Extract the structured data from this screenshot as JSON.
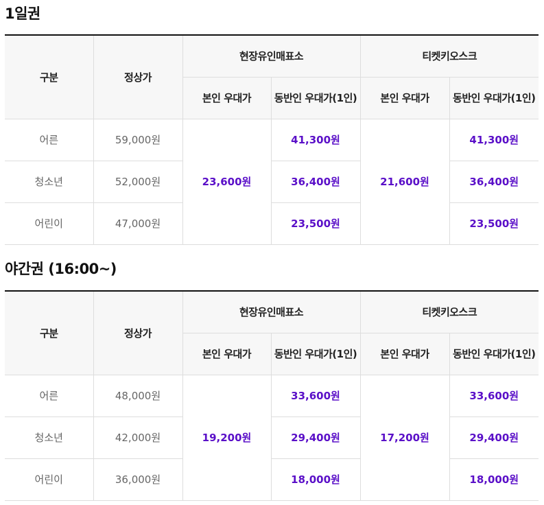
{
  "colors": {
    "accent": "#5a0fc8",
    "header_bg": "#f7f7f7",
    "border": "#dddddd",
    "top_border": "#111111"
  },
  "headers": {
    "category": "구분",
    "regular_price": "정상가",
    "onsite": "현장유인매표소",
    "kiosk": "티켓키오스크",
    "self_discount": "본인 우대가",
    "companion_discount": "동반인 우대가(1인)"
  },
  "sections": [
    {
      "title": "1일권",
      "self_onsite": "23,600원",
      "self_kiosk": "21,600원",
      "rows": [
        {
          "category": "어른",
          "regular": "59,000원",
          "companion_onsite": "41,300원",
          "companion_kiosk": "41,300원"
        },
        {
          "category": "청소년",
          "regular": "52,000원",
          "companion_onsite": "36,400원",
          "companion_kiosk": "36,400원"
        },
        {
          "category": "어린이",
          "regular": "47,000원",
          "companion_onsite": "23,500원",
          "companion_kiosk": "23,500원"
        }
      ]
    },
    {
      "title": "야간권 (16:00~)",
      "self_onsite": "19,200원",
      "self_kiosk": "17,200원",
      "rows": [
        {
          "category": "어른",
          "regular": "48,000원",
          "companion_onsite": "33,600원",
          "companion_kiosk": "33,600원"
        },
        {
          "category": "청소년",
          "regular": "42,000원",
          "companion_onsite": "29,400원",
          "companion_kiosk": "29,400원"
        },
        {
          "category": "어린이",
          "regular": "36,000원",
          "companion_onsite": "18,000원",
          "companion_kiosk": "18,000원"
        }
      ]
    }
  ]
}
